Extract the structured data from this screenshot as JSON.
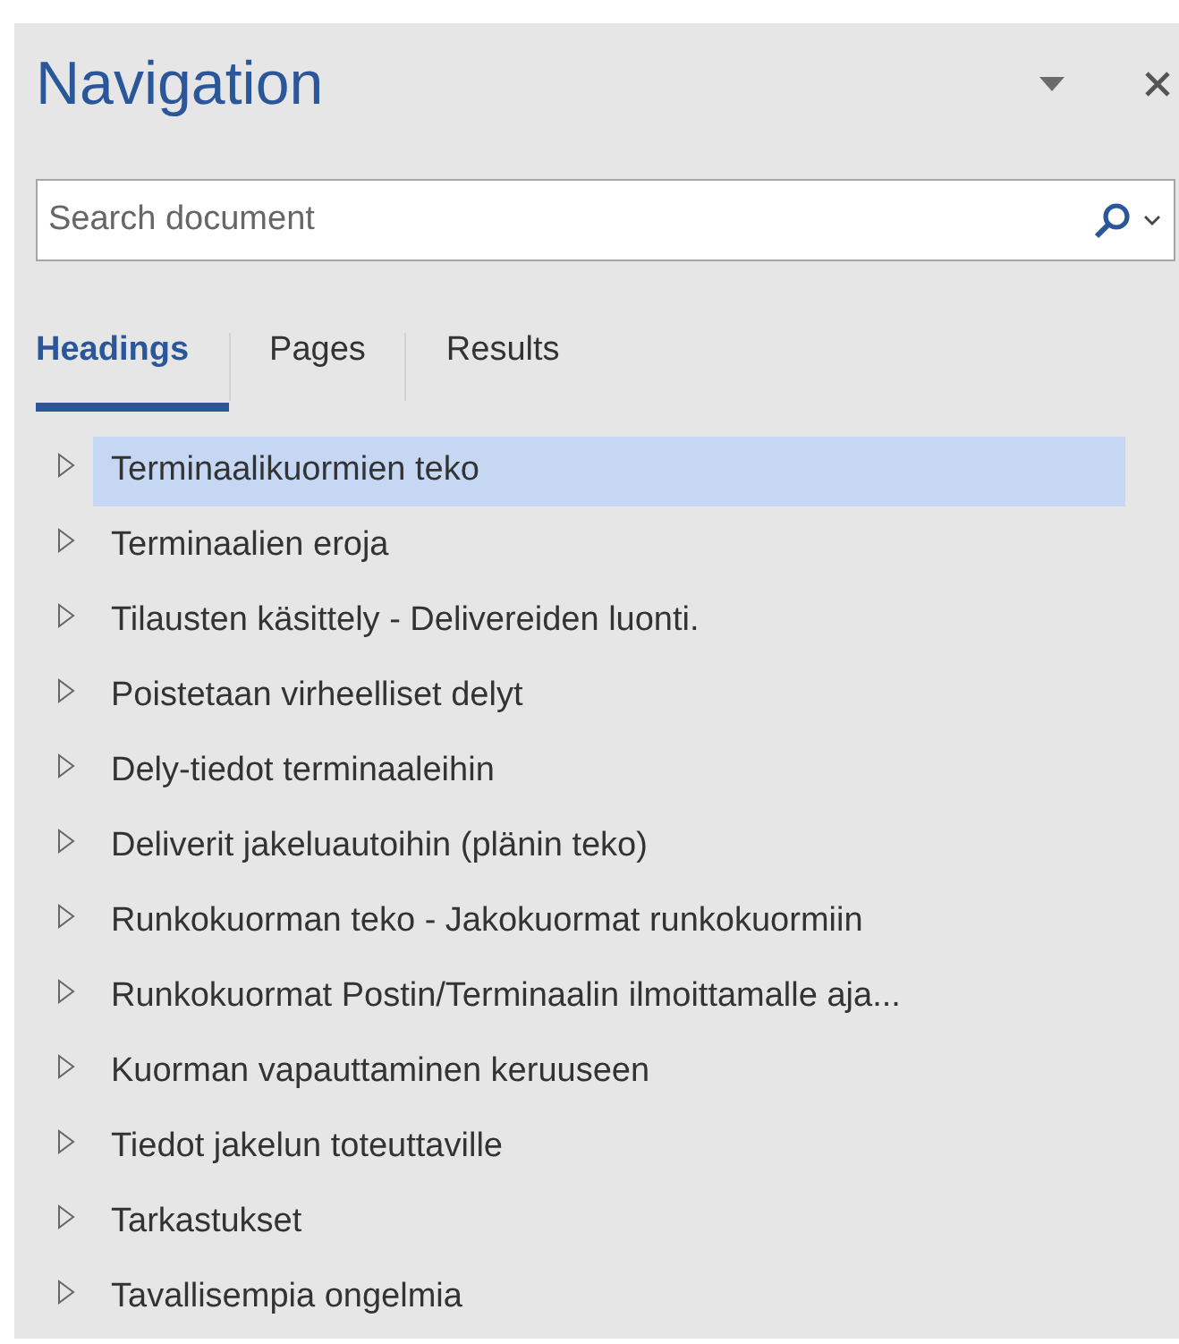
{
  "pane": {
    "title": "Navigation"
  },
  "search": {
    "placeholder": "Search document"
  },
  "tabs": [
    {
      "label": "Headings",
      "selected": true
    },
    {
      "label": "Pages",
      "selected": false
    },
    {
      "label": "Results",
      "selected": false
    }
  ],
  "headings": [
    {
      "label": "Terminaalikuormien teko",
      "selected": true,
      "expanded": false
    },
    {
      "label": "Terminaalien eroja",
      "selected": false,
      "expanded": false
    },
    {
      "label": "Tilausten käsittely - Delivereiden luonti.",
      "selected": false,
      "expanded": false
    },
    {
      "label": "Poistetaan virheelliset delyt",
      "selected": false,
      "expanded": false
    },
    {
      "label": "Dely-tiedot terminaaleihin",
      "selected": false,
      "expanded": false
    },
    {
      "label": "Deliverit jakeluautoihin (plänin teko)",
      "selected": false,
      "expanded": false
    },
    {
      "label": "Runkokuorman teko - Jakokuormat runkokuormiin",
      "selected": false,
      "expanded": false
    },
    {
      "label": "Runkokuormat Postin/Terminaalin ilmoittamalle aja...",
      "selected": false,
      "expanded": false
    },
    {
      "label": "Kuorman vapauttaminen keruuseen",
      "selected": false,
      "expanded": false
    },
    {
      "label": "Tiedot jakelun toteuttaville",
      "selected": false,
      "expanded": false
    },
    {
      "label": "Tarkastukset",
      "selected": false,
      "expanded": false
    },
    {
      "label": "Tavallisempia ongelmia",
      "selected": false,
      "expanded": false
    }
  ]
}
